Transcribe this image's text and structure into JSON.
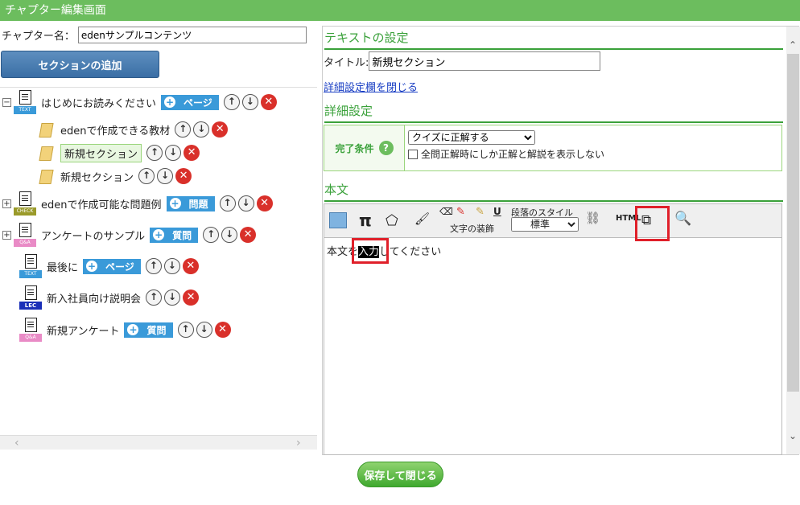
{
  "window": {
    "title": "チャプター編集画面"
  },
  "chapter": {
    "label": "チャプター名：",
    "name": "edenサンプルコンテンツ"
  },
  "sidebar": {
    "add_section_label": "セクションの追加",
    "items": [
      {
        "label": "はじめにお読みください",
        "tag": "TEXT",
        "type_label": "ページ",
        "expander": "−"
      },
      {
        "label": "edenで作成できる教材"
      },
      {
        "label": "新規セクション"
      },
      {
        "label": "新規セクション"
      },
      {
        "label": "edenで作成可能な問題例",
        "tag": "CHECK",
        "type_label": "問題",
        "expander": "+"
      },
      {
        "label": "アンケートのサンプル",
        "tag": "Q&A",
        "type_label": "質問",
        "expander": "+"
      },
      {
        "label": "最後に",
        "tag": "TEXT",
        "type_label": "ページ"
      },
      {
        "label": "新入社員向け説明会",
        "tag": "LEC"
      },
      {
        "label": "新規アンケート",
        "tag": "Q&A",
        "type_label": "質問"
      }
    ]
  },
  "text_settings": {
    "heading": "テキストの設定",
    "title_label": "タイトル:",
    "title_value": "新規セクション",
    "close_details_link": "詳細設定欄を閉じる"
  },
  "details": {
    "heading": "詳細設定",
    "completion_label": "完了条件",
    "completion_select": "クイズに正解する",
    "checkbox_label": "全問正解時にしか正解と解説を表示しない"
  },
  "body": {
    "heading": "本文",
    "toolbar": {
      "text_decoration_label": "文字の装飾",
      "paragraph_style_label": "段落のスタイル",
      "paragraph_style_value": "標準",
      "html_label": "HTML"
    },
    "content_before": "本文を",
    "content_selected": "入力",
    "content_after": "してください"
  },
  "footer": {
    "save_label": "保存して閉じる"
  },
  "colors": {
    "accent": "#6cbd5e",
    "section_heading": "#3aa13a",
    "highlight": "#e0202a",
    "type_button": "#3a9ad9"
  }
}
